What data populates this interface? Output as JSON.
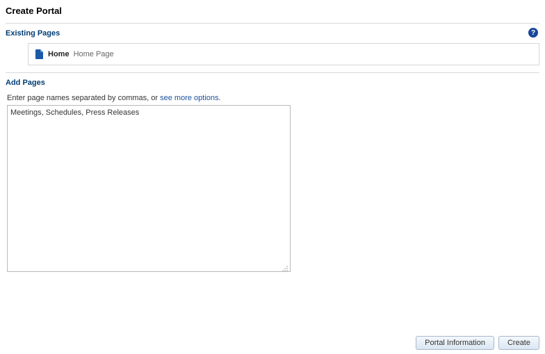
{
  "header": {
    "title": "Create Portal"
  },
  "help": {
    "glyph": "?"
  },
  "existing": {
    "heading": "Existing Pages",
    "items": [
      {
        "name": "Home",
        "desc": "Home Page"
      }
    ]
  },
  "add": {
    "heading": "Add Pages",
    "instruction_prefix": "Enter page names separated by commas, or ",
    "instruction_link": "see more options",
    "instruction_suffix": ".",
    "textarea_value": "Meetings, Schedules, Press Releases"
  },
  "footer": {
    "back_label": "Portal Information",
    "create_label": "Create"
  }
}
